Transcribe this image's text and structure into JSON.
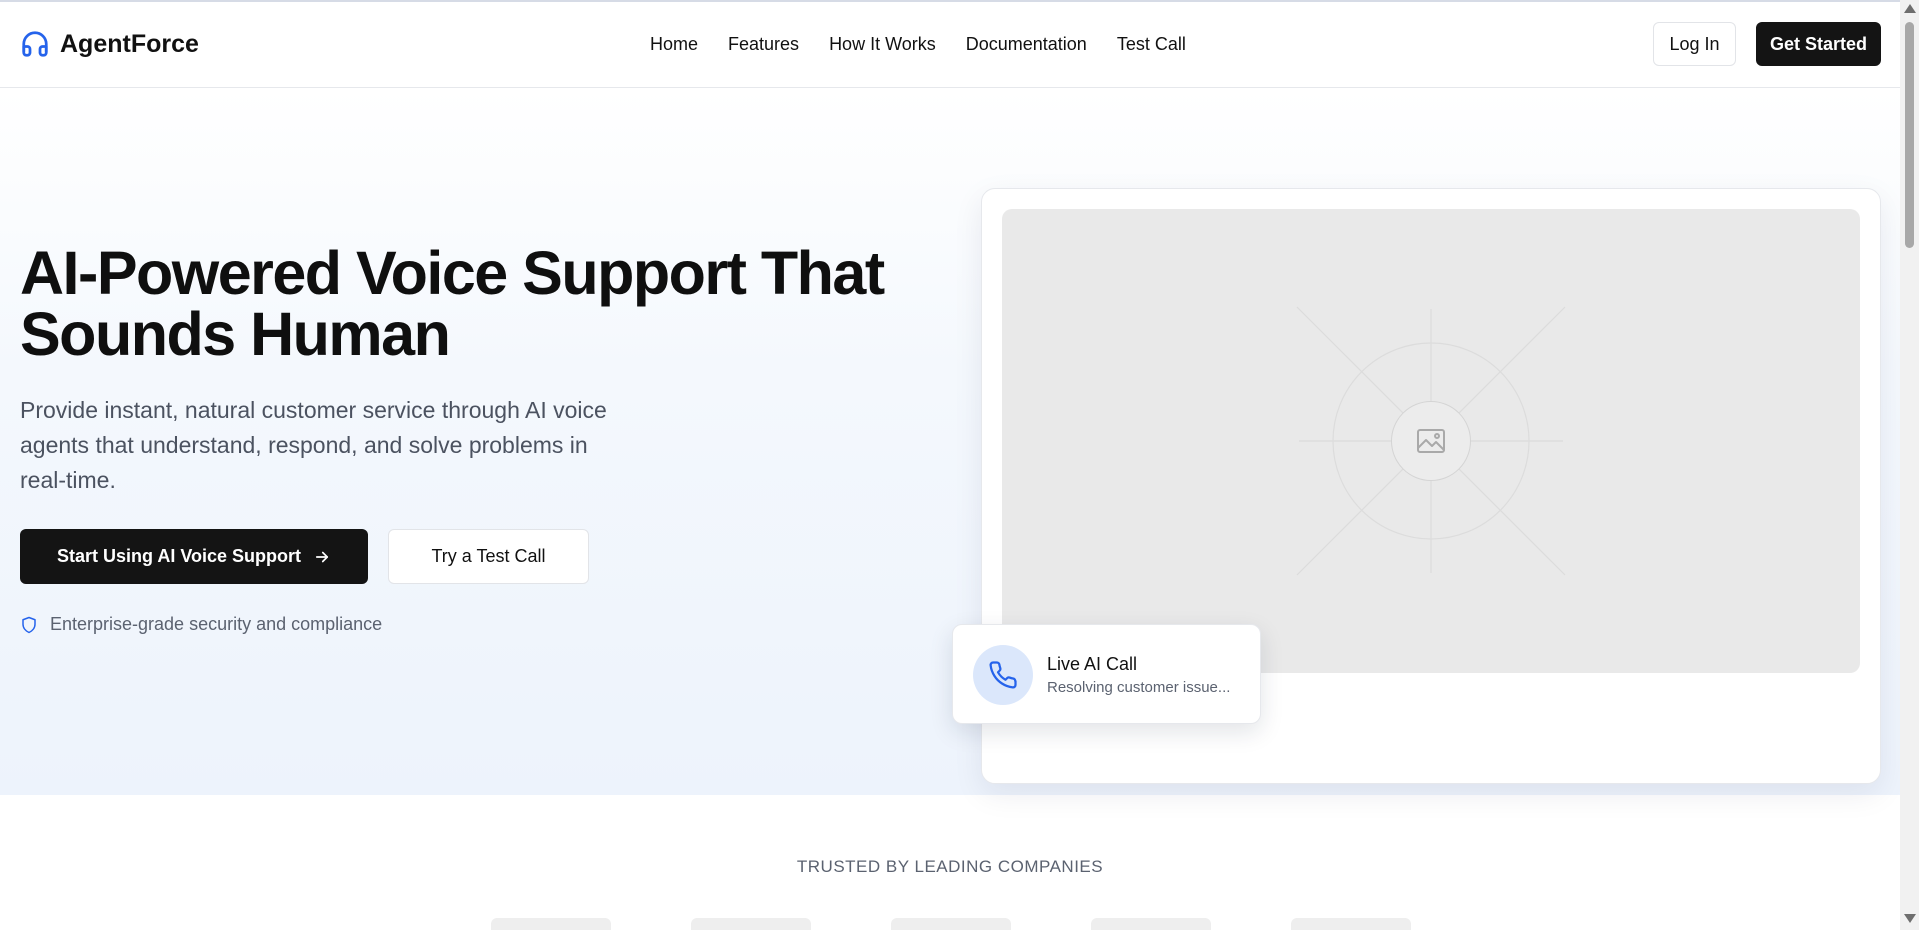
{
  "header": {
    "logo_text": "AgentForce",
    "logo_icon": "headphones-icon",
    "nav": [
      "Home",
      "Features",
      "How It Works",
      "Documentation",
      "Test Call"
    ],
    "login_label": "Log In",
    "get_started_label": "Get Started"
  },
  "hero": {
    "title": "AI-Powered Voice Support That Sounds Human",
    "subtitle": "Provide instant, natural customer service through AI voice agents that understand, respond, and solve problems in real-time.",
    "primary_button": "Start Using AI Voice Support",
    "primary_button_icon": "arrow-right-icon",
    "secondary_button": "Try a Test Call",
    "security_icon": "shield-icon",
    "security_text": "Enterprise-grade security and compliance"
  },
  "media": {
    "placeholder_icon": "image-icon",
    "live_call": {
      "icon": "phone-icon",
      "title": "Live AI Call",
      "subtitle": "Resolving customer issue..."
    }
  },
  "trusted": {
    "heading": "TRUSTED BY LEADING COMPANIES"
  },
  "colors": {
    "primary_dark": "#141414",
    "accent_blue": "#2563eb",
    "hero_bg": "#edf3fc",
    "muted_text": "#5b6270"
  }
}
